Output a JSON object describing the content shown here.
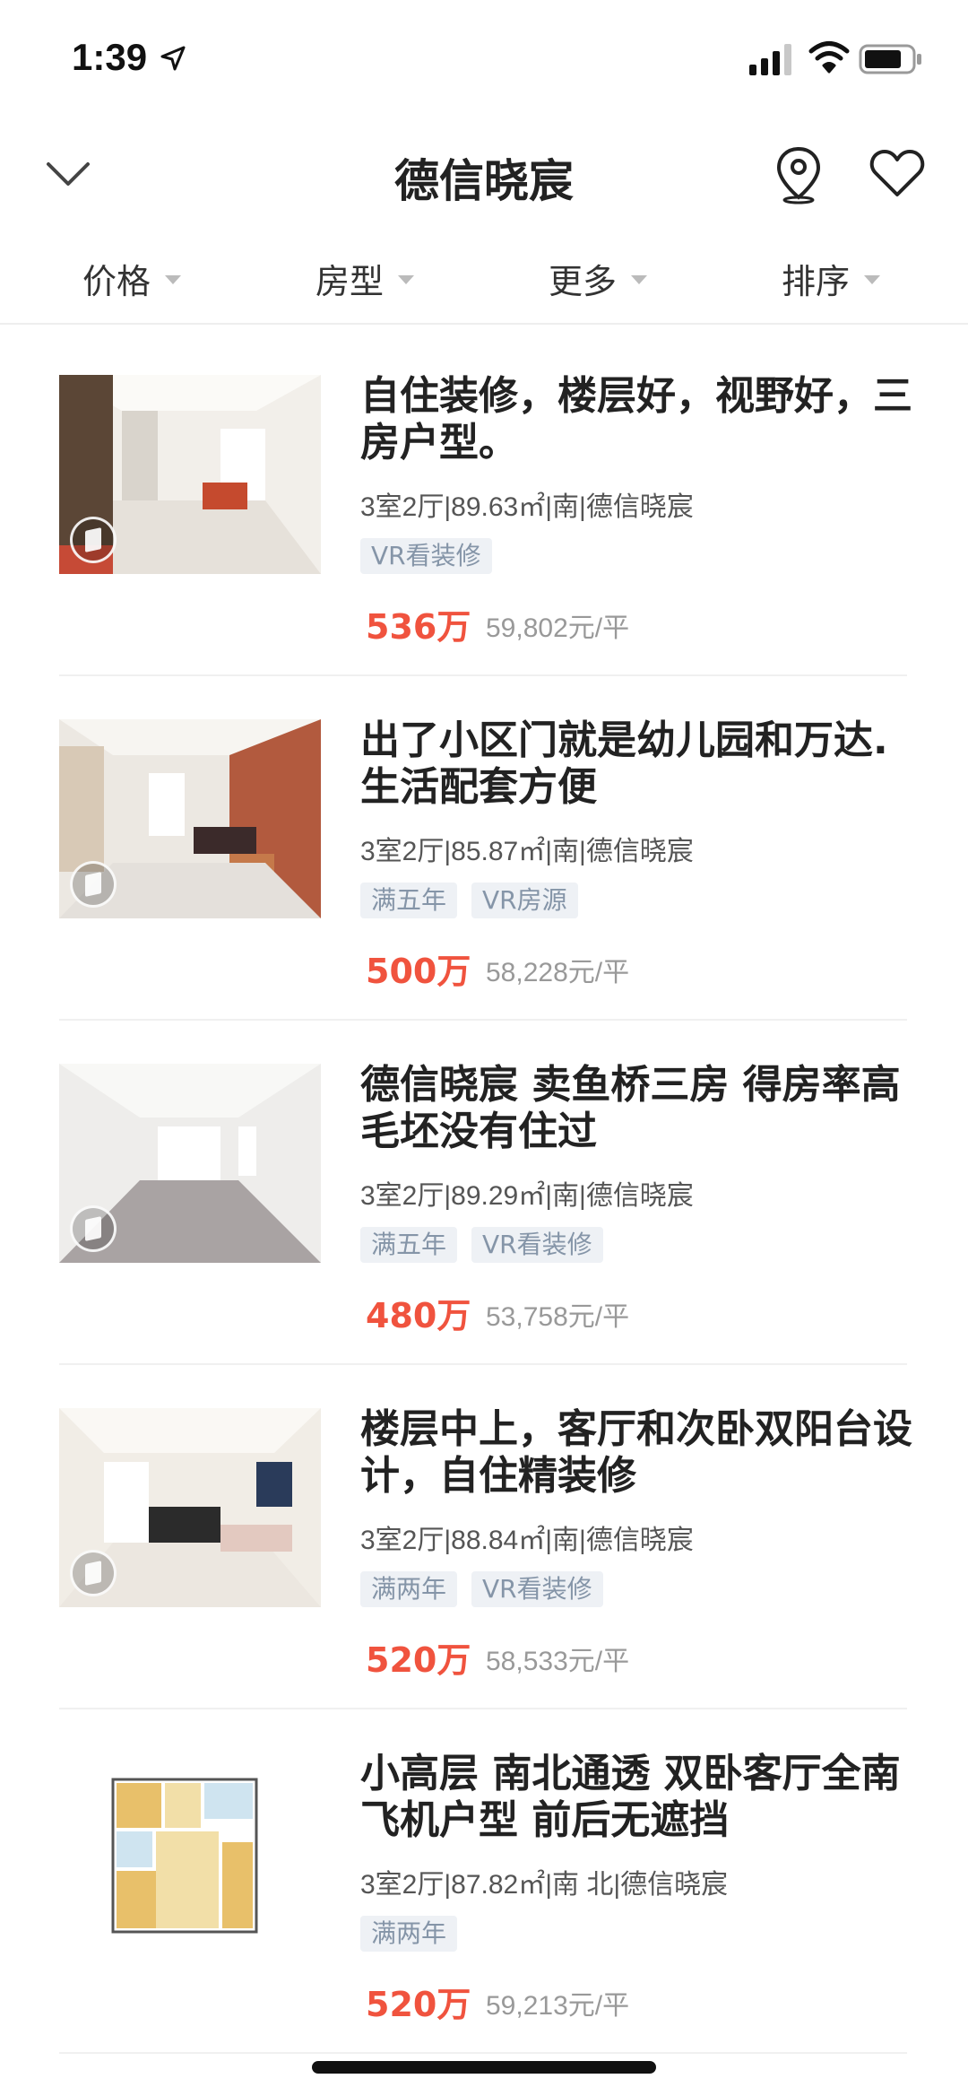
{
  "status": {
    "time": "1:39"
  },
  "header": {
    "title": "德信晓宸"
  },
  "filters": [
    "价格",
    "房型",
    "更多",
    "排序"
  ],
  "listings": [
    {
      "title": "自住装修，楼层好，视野好，三房户型。",
      "info": "3室2厅|89.63㎡|南|德信晓宸",
      "tags": [
        "VR看装修"
      ],
      "price": "536万",
      "unit_price": "59,802元/平"
    },
    {
      "title": "出了小区门就是幼儿园和万达.生活配套方便",
      "info": "3室2厅|85.87㎡|南|德信晓宸",
      "tags": [
        "满五年",
        "VR房源"
      ],
      "price": "500万",
      "unit_price": "58,228元/平"
    },
    {
      "title": "德信晓宸 卖鱼桥三房 得房率高毛坯没有住过",
      "info": "3室2厅|89.29㎡|南|德信晓宸",
      "tags": [
        "满五年",
        "VR看装修"
      ],
      "price": "480万",
      "unit_price": "53,758元/平"
    },
    {
      "title": "楼层中上，客厅和次卧双阳台设计，自住精装修",
      "info": "3室2厅|88.84㎡|南|德信晓宸",
      "tags": [
        "满两年",
        "VR看装修"
      ],
      "price": "520万",
      "unit_price": "58,533元/平"
    },
    {
      "title": "小高层 南北通透 双卧客厅全南飞机户型 前后无遮挡",
      "info": "3室2厅|87.82㎡|南 北|德信晓宸",
      "tags": [
        "满两年"
      ],
      "price": "520万",
      "unit_price": "59,213元/平"
    }
  ]
}
